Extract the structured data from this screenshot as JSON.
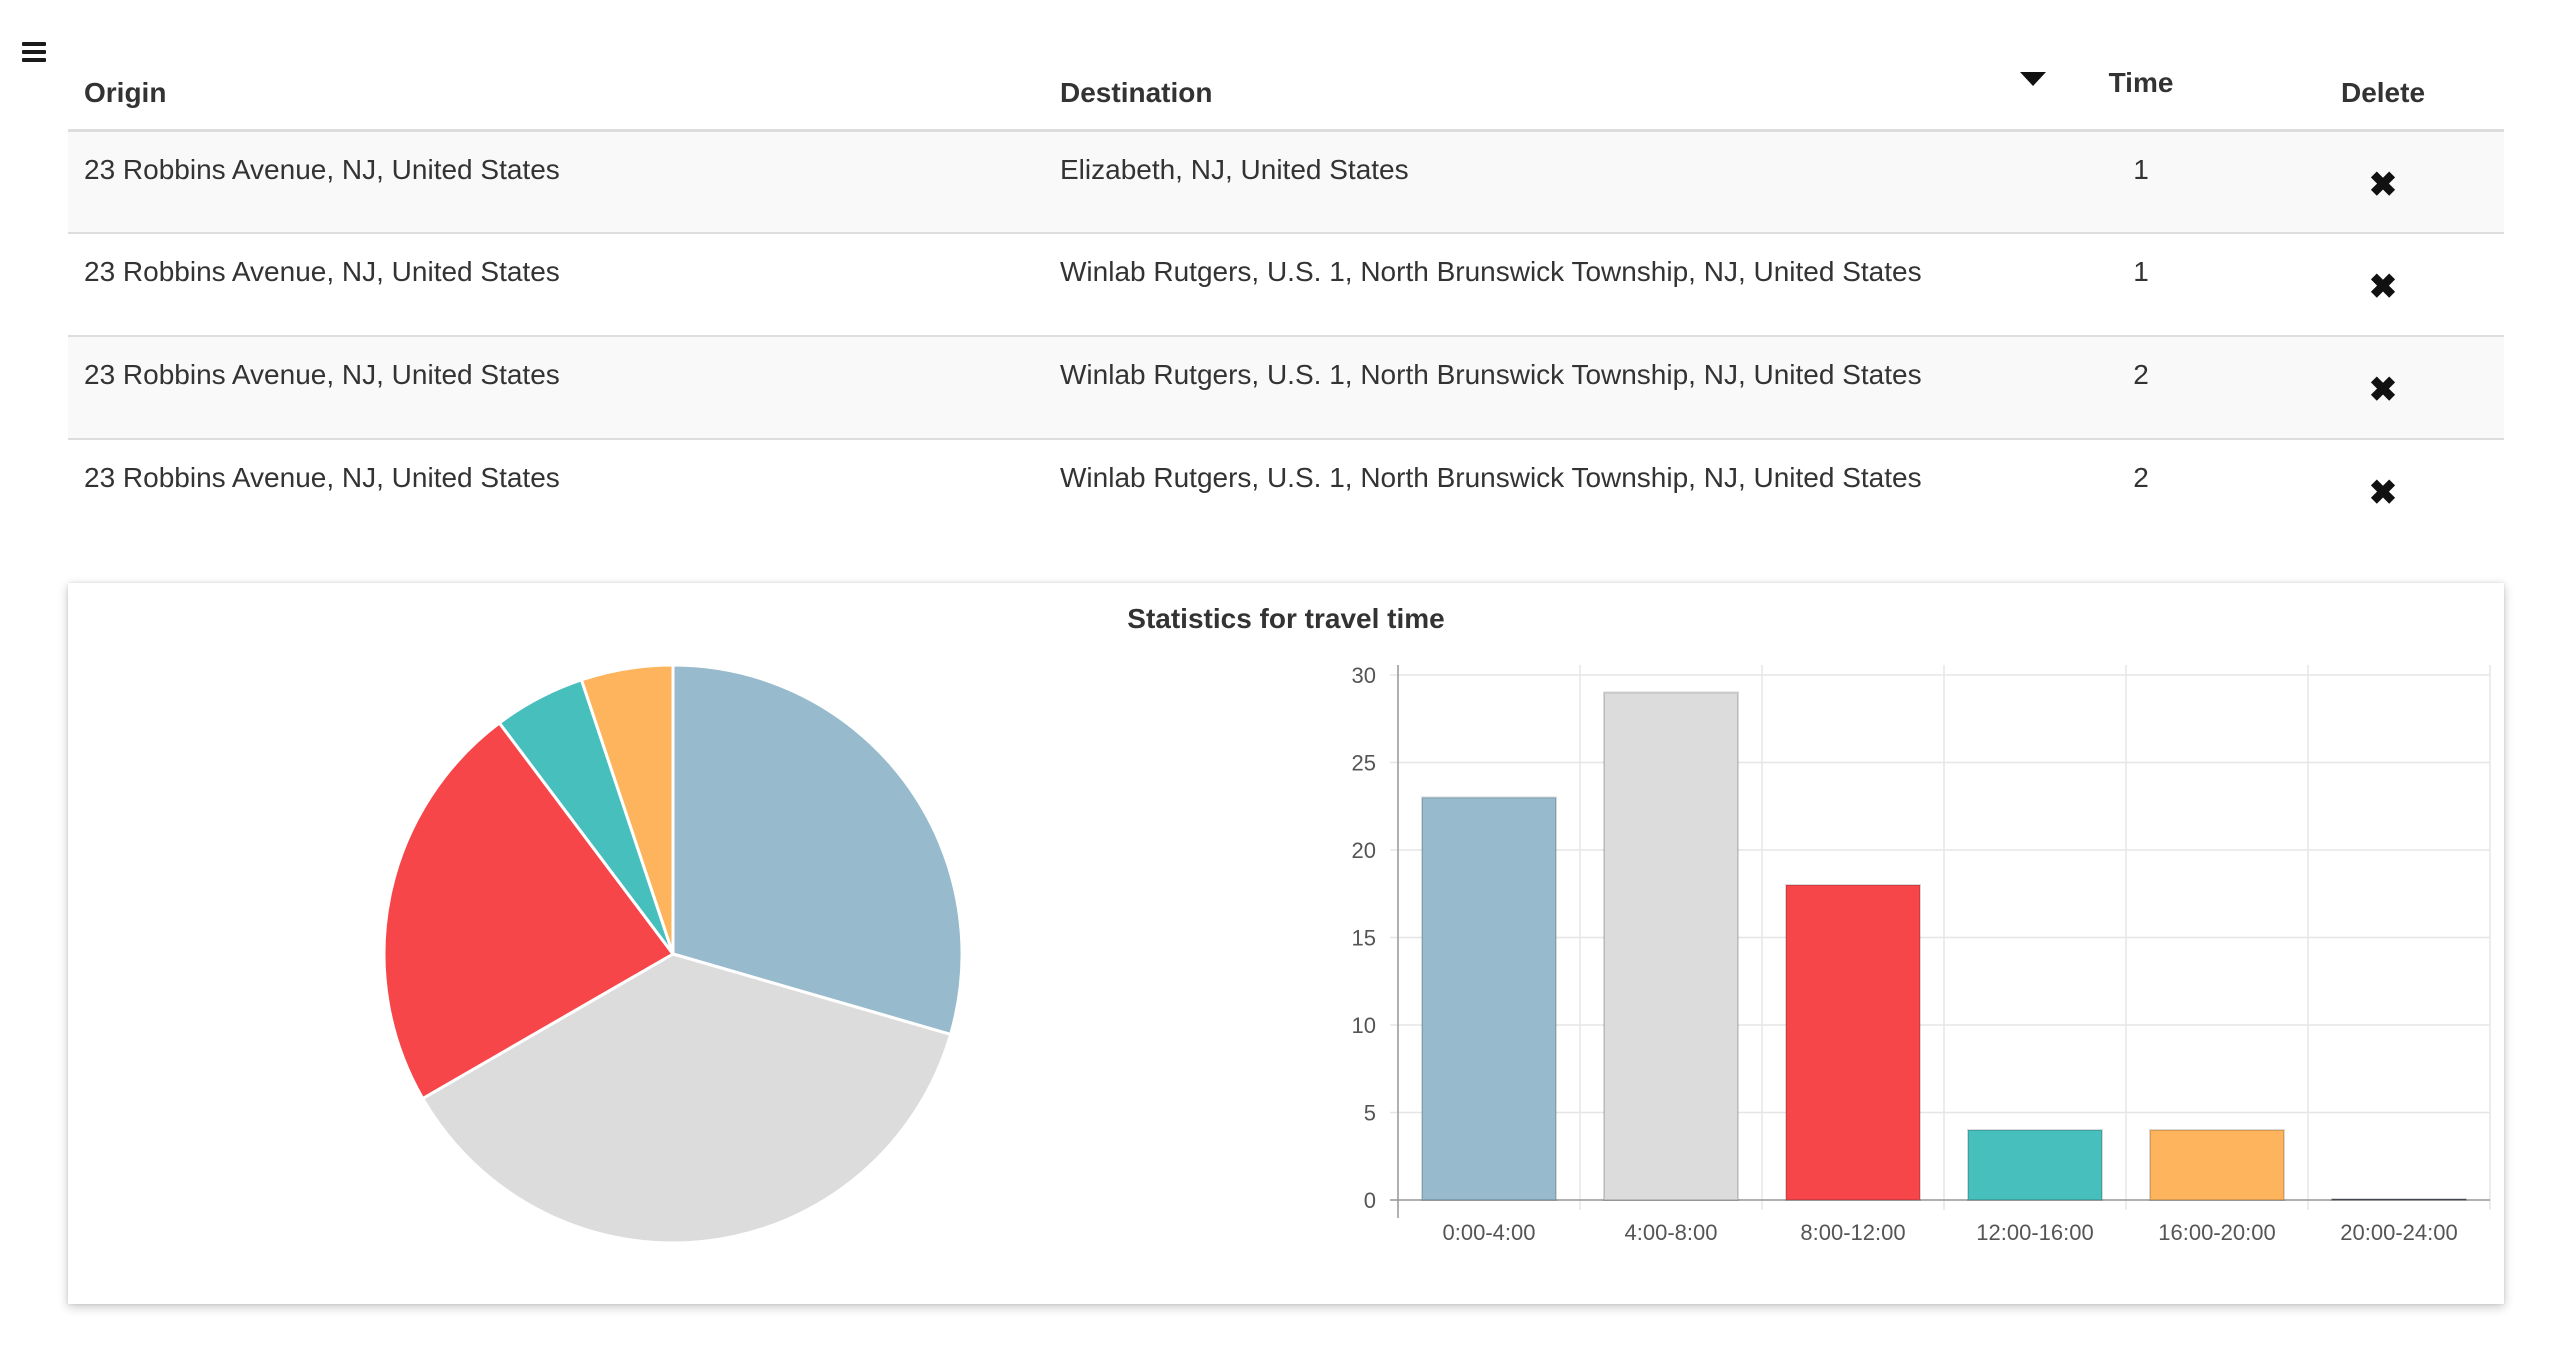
{
  "menu": {
    "icon": "hamburger-menu-icon"
  },
  "table": {
    "headers": {
      "origin": "Origin",
      "destination": "Destination",
      "time": "Time",
      "delete": "Delete"
    },
    "sort_icon": "sort-descending-icon",
    "delete_icon": "close-x-icon",
    "delete_glyph": "✖",
    "rows": [
      {
        "origin": "23 Robbins Avenue, NJ, United States",
        "destination": "Elizabeth, NJ, United States",
        "time": "1"
      },
      {
        "origin": "23 Robbins Avenue, NJ, United States",
        "destination": "Winlab Rutgers, U.S. 1, North Brunswick Township, NJ, United States",
        "time": "1"
      },
      {
        "origin": "23 Robbins Avenue, NJ, United States",
        "destination": "Winlab Rutgers, U.S. 1, North Brunswick Township, NJ, United States",
        "time": "2"
      },
      {
        "origin": "23 Robbins Avenue, NJ, United States",
        "destination": "Winlab Rutgers, U.S. 1, North Brunswick Township, NJ, United States",
        "time": "2"
      }
    ]
  },
  "stats": {
    "title": "Statistics for travel time"
  },
  "chart_data": [
    {
      "type": "pie",
      "categories": [
        "0:00-4:00",
        "4:00-8:00",
        "8:00-12:00",
        "12:00-16:00",
        "16:00-20:00",
        "20:00-24:00"
      ],
      "values": [
        23,
        29,
        18,
        4,
        4,
        0
      ],
      "colors": [
        "#97bbcd",
        "#dcdcdc",
        "#f7464a",
        "#46bfbd",
        "#fdb45c",
        "#4d5360"
      ]
    },
    {
      "type": "bar",
      "categories": [
        "0:00-4:00",
        "4:00-8:00",
        "8:00-12:00",
        "12:00-16:00",
        "16:00-20:00",
        "20:00-24:00"
      ],
      "values": [
        23,
        29,
        18,
        4,
        4,
        0
      ],
      "colors": [
        "#97bbcd",
        "#dcdcdc",
        "#f7464a",
        "#46bfbd",
        "#fdb45c",
        "#4d5360"
      ],
      "ylim": [
        0,
        30
      ],
      "yticks": [
        "0",
        "5",
        "10",
        "15",
        "20",
        "25",
        "30"
      ],
      "grid": true
    }
  ]
}
